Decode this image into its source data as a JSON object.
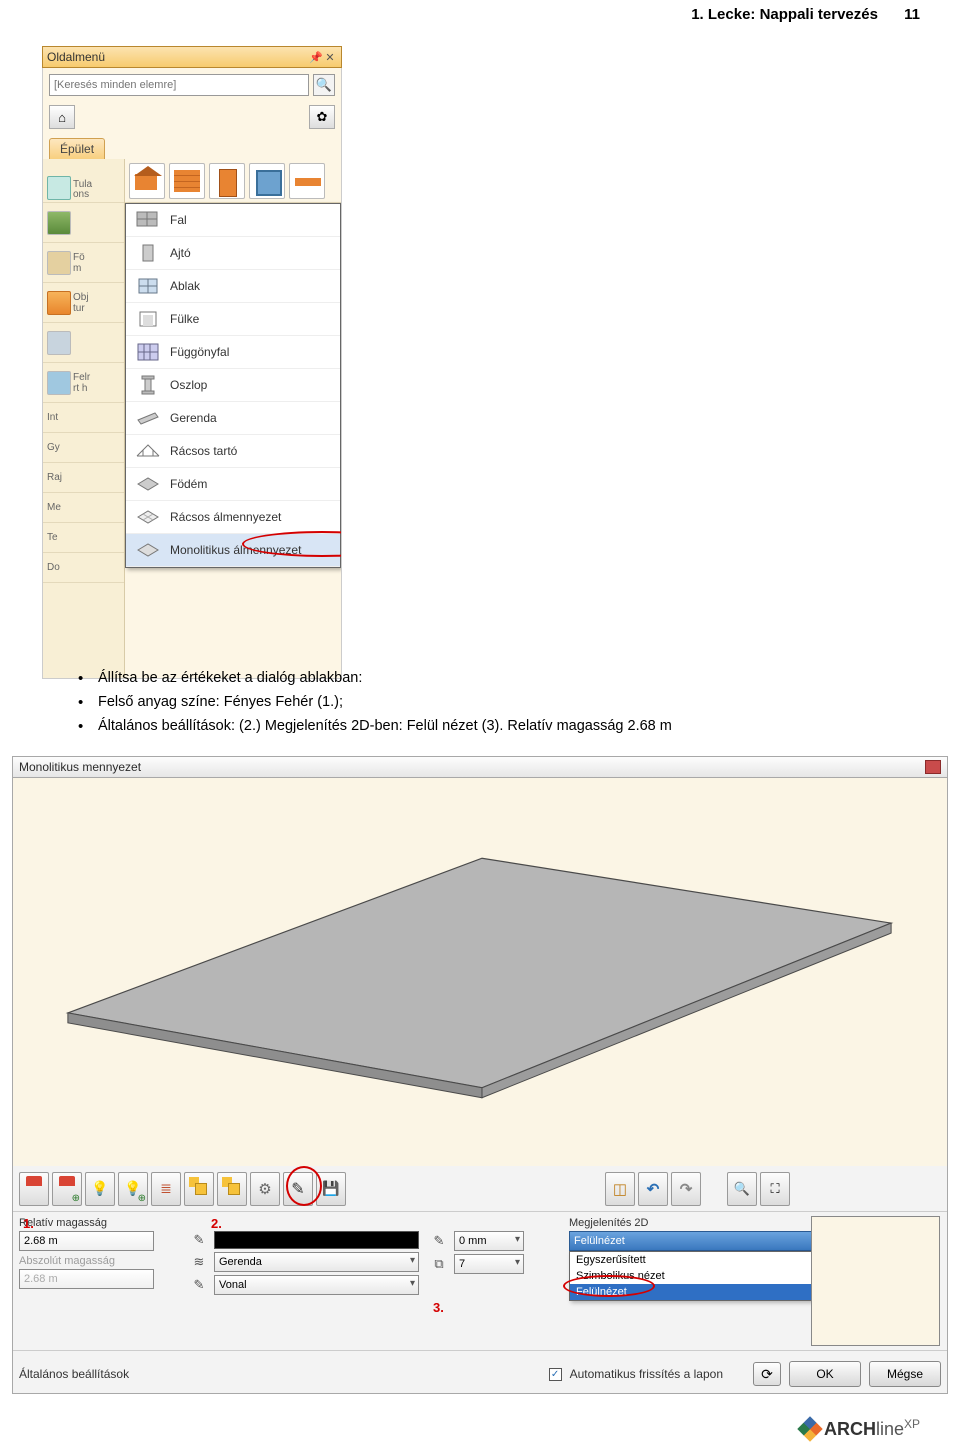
{
  "header": {
    "title": "1. Lecke: Nappali tervezés",
    "page": "11"
  },
  "sidepanel": {
    "title": "Oldalmenü",
    "search_placeholder": "[Keresés minden elemre]",
    "tab": "Épület",
    "left_labels": [
      "Tula",
      "ons",
      "",
      "Fö",
      "m",
      "Obj",
      "tur",
      "",
      "Felr",
      "rt h",
      "Int",
      "Gy",
      "Raj",
      "Me",
      "Te",
      "Do"
    ],
    "menu": [
      "Fal",
      "Ajtó",
      "Ablak",
      "Fülke",
      "Függönyfal",
      "Oszlop",
      "Gerenda",
      "Rácsos tartó",
      "Födém",
      "Rácsos álmennyezet",
      "Monolitikus álmennyezet"
    ]
  },
  "instructions": {
    "line1": "Állítsa be az értékeket a dialóg ablakban:",
    "line2": "Felső anyag színe: Fényes Fehér (1.);",
    "line3": "Általános beállítások: (2.) Megjelenítés 2D-ben: Felül nézet (3). Relatív magasság 2.68 m"
  },
  "dialog": {
    "title": "Monolitikus mennyezet",
    "rel_label": "Relatív magasság",
    "rel_value": "2.68 m",
    "abs_label": "Abszolút magasság",
    "abs_value": "2.68 m",
    "line_width": "0 mm",
    "layer_name": "Gerenda",
    "layer_num": "7",
    "line_type": "Vonal",
    "disp2d_label": "Megjelenítés 2D",
    "disp2d_value": "Felülnézet",
    "dd_options": [
      "Egyszerűsített",
      "Szimbolikus nézet",
      "Felülnézet"
    ],
    "footer_label": "Általános beállítások",
    "auto_refresh": "Automatikus frissítés a lapon",
    "ok": "OK",
    "cancel": "Mégse",
    "anno1": "1.",
    "anno2": "2.",
    "anno3": "3."
  },
  "footer": {
    "brand1": "ARCH",
    "brand2": "line",
    "brand3": "XP"
  }
}
